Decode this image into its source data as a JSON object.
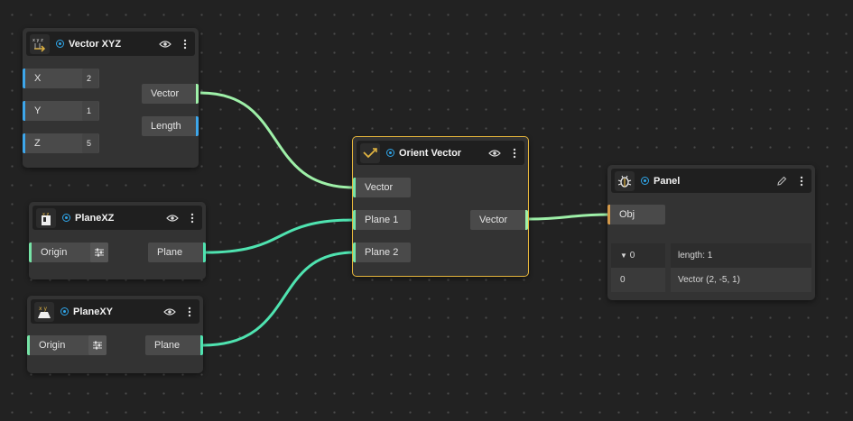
{
  "nodes": {
    "vector_xyz": {
      "title": "Vector XYZ",
      "inputs": [
        {
          "label": "X",
          "value": "2"
        },
        {
          "label": "Y",
          "value": "1"
        },
        {
          "label": "Z",
          "value": "5"
        }
      ],
      "outputs": [
        "Vector",
        "Length"
      ]
    },
    "plane_xz": {
      "title": "PlaneXZ",
      "input": "Origin",
      "output": "Plane"
    },
    "plane_xy": {
      "title": "PlaneXY",
      "input": "Origin",
      "output": "Plane"
    },
    "orient_vector": {
      "title": "Orient Vector",
      "inputs": [
        "Vector",
        "Plane 1",
        "Plane 2"
      ],
      "output": "Vector"
    },
    "panel": {
      "title": "Panel",
      "input": "Obj",
      "rows": [
        {
          "index": "0",
          "value": "length: 1"
        },
        {
          "index": "0",
          "value": "Vector (2, -5, 1)"
        }
      ]
    }
  },
  "icons": {
    "visibility": "eye-icon",
    "menu": "more-vertical-icon",
    "edit": "pencil-icon",
    "settings": "sliders-icon",
    "expand": "caret-down-icon",
    "live": "live-dot-icon"
  },
  "colors": {
    "background": "#222222",
    "node": "#333333",
    "selected_border": "#e5b53c",
    "wire_vector": "#9ef0a8",
    "wire_plane": "#4fe3b0",
    "port_number": "#3da6ea",
    "port_plane": "#76e3a6",
    "port_any": "#d59a4a"
  }
}
